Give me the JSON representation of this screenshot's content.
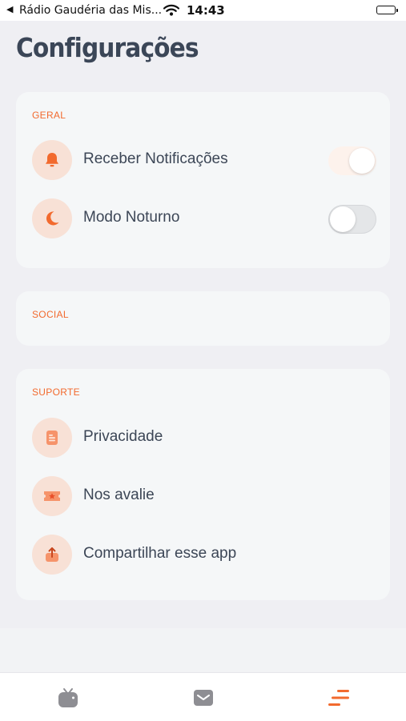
{
  "status_bar": {
    "back_app": "Rádio Gaudéria das Mis...",
    "time": "14:43"
  },
  "header": {
    "title": "Configurações"
  },
  "sections": {
    "geral": {
      "label": "GERAL",
      "items": [
        {
          "label": "Receber Notificações",
          "icon": "bell-icon",
          "toggle": true
        },
        {
          "label": "Modo Noturno",
          "icon": "moon-icon",
          "toggle": false
        }
      ]
    },
    "social": {
      "label": "SOCIAL"
    },
    "suporte": {
      "label": "SUPORTE",
      "items": [
        {
          "label": "Privacidade",
          "icon": "document-icon"
        },
        {
          "label": "Nos avalie",
          "icon": "star-ticket-icon"
        },
        {
          "label": "Compartilhar esse app",
          "icon": "share-icon"
        }
      ]
    }
  },
  "tab_bar": {
    "tabs": [
      {
        "icon": "tv-icon",
        "active": false
      },
      {
        "icon": "mail-icon",
        "active": false
      },
      {
        "icon": "menu-icon",
        "active": true
      }
    ]
  },
  "colors": {
    "accent": "#f26a2e",
    "icon_bg": "#f8e1d6",
    "card_bg": "#f5f7f8",
    "page_bg": "#efeff3",
    "text": "#3c4656",
    "inactive_tab": "#8e8e93"
  }
}
